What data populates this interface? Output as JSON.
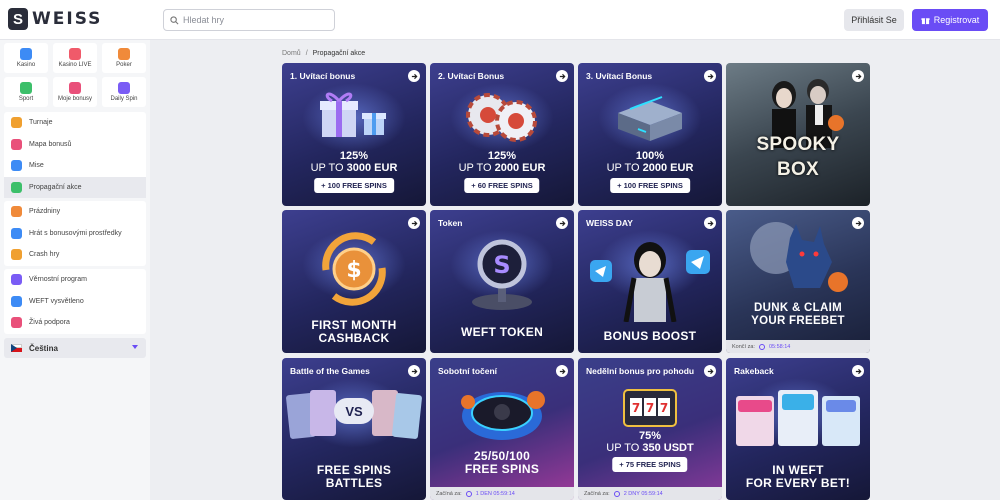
{
  "header": {
    "logo_mark": "S",
    "logo_text": "WEISS",
    "search_placeholder": "Hledat hry",
    "login_label": "Přihlásit Se",
    "register_label": "Registrovat"
  },
  "sidebar": {
    "tiles": [
      {
        "label": "Kasino",
        "icon": "casino-icon",
        "color": "#3d8bf5"
      },
      {
        "label": "Kasino LIVE",
        "icon": "live-icon",
        "color": "#f05a6a"
      },
      {
        "label": "Poker",
        "icon": "poker-icon",
        "color": "#f08a3a"
      },
      {
        "label": "Sport",
        "icon": "sport-icon",
        "color": "#3cbf6a"
      },
      {
        "label": "Moje bonusy",
        "icon": "gift-icon",
        "color": "#e9507a"
      },
      {
        "label": "Daily Spin",
        "icon": "spin-icon",
        "color": "#7a5cf5"
      }
    ],
    "group1": [
      {
        "label": "Turnaje",
        "icon": "trophy-icon",
        "color": "#f0a030"
      },
      {
        "label": "Mapa bonusů",
        "icon": "map-icon",
        "color": "#e9507a"
      },
      {
        "label": "Mise",
        "icon": "mission-icon",
        "color": "#3d8bf5"
      },
      {
        "label": "Propagační akce",
        "icon": "promo-icon",
        "color": "#3cbf6a"
      }
    ],
    "group2": [
      {
        "label": "Prázdniny",
        "icon": "holiday-icon",
        "color": "#f08a3a"
      },
      {
        "label": "Hrát s bonusovými prostředky",
        "icon": "bonus-funds-icon",
        "color": "#3d8bf5"
      },
      {
        "label": "Crash hry",
        "icon": "crash-icon",
        "color": "#f0a030"
      }
    ],
    "group3": [
      {
        "label": "Věrnostní program",
        "icon": "loyalty-icon",
        "color": "#7a5cf5"
      },
      {
        "label": "WEFT vysvětleno",
        "icon": "weft-icon",
        "color": "#3d8bf5"
      },
      {
        "label": "Živá podpora",
        "icon": "support-icon",
        "color": "#e9507a"
      }
    ],
    "language": "Čeština"
  },
  "breadcrumb": {
    "home": "Domů",
    "separator": "/",
    "current": "Propagační akce"
  },
  "cards": [
    {
      "title": "1. Uvítací bonus",
      "line1": "125%",
      "line2_pre": "UP TO ",
      "line2_bold": "3000 EUR",
      "pill": "+ 100 FREE SPINS"
    },
    {
      "title": "2. Uvítací Bonus",
      "line1": "125%",
      "line2_pre": "UP TO ",
      "line2_bold": "2000 EUR",
      "pill": "+ 60 FREE SPINS"
    },
    {
      "title": "3. Uvítací Bonus",
      "line1": "100%",
      "line2_pre": "UP TO ",
      "line2_bold": "2000 EUR",
      "pill": "+ 100 FREE SPINS"
    },
    {
      "title": "",
      "big1": "SPOOKY",
      "big2": "BOX"
    },
    {
      "title": "",
      "big1": "FIRST MONTH",
      "big2": "CASHBACK"
    },
    {
      "title": "Token",
      "big1": "WEFT TOKEN"
    },
    {
      "title": "WEISS DAY",
      "big1": "BONUS BOOST"
    },
    {
      "title": "",
      "big1": "DUNK & CLAIM",
      "big2": "YOUR FREEBET",
      "foot_label": "Končí za:",
      "foot_time": "05:58:14"
    },
    {
      "title": "Battle of the Games",
      "vs": "VS",
      "big1": "FREE SPINS",
      "big2": "BATTLES"
    },
    {
      "title": "Sobotní točení",
      "big1": "25/50/100",
      "big2": "FREE SPINS",
      "foot_label": "Začíná za:",
      "foot_time": "1 DEN 05:59:14"
    },
    {
      "title": "Nedělní bonus pro pohodu",
      "line1": "75%",
      "line2_pre": "UP TO ",
      "line2_bold": "350 USDT",
      "pill": "+ 75 FREE SPINS",
      "foot_label": "Začíná za:",
      "foot_time": "2 DNY 05:59:14"
    },
    {
      "title": "Rakeback",
      "big1": "IN WEFT",
      "big2": "FOR EVERY BET!"
    }
  ]
}
